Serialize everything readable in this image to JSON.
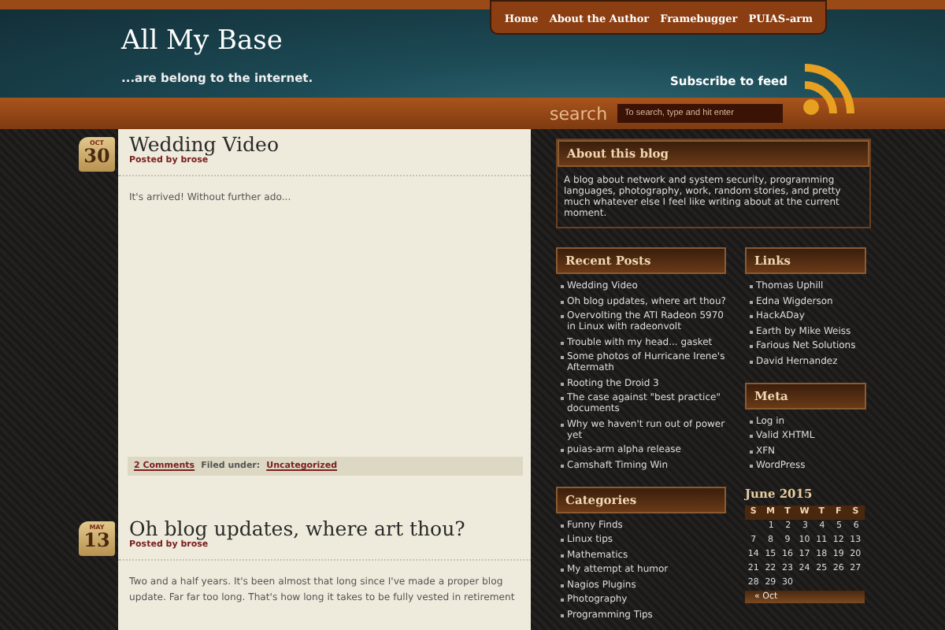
{
  "nav": [
    "Home",
    "About the Author",
    "Framebugger",
    "PUIAS-arm"
  ],
  "site": {
    "title": "All My Base",
    "tagline": "...are belong to the internet.",
    "subscribe": "Subscribe to feed"
  },
  "search": {
    "label": "search",
    "placeholder": "To search, type and hit enter"
  },
  "posts": [
    {
      "month": "OCT",
      "day": "30",
      "title": "Wedding Video",
      "byline": "Posted by brose",
      "body": [
        "It's arrived! Without further ado..."
      ],
      "comments": "2 Comments",
      "filed_label": "Filed under:",
      "category": "Uncategorized"
    },
    {
      "month": "MAY",
      "day": "13",
      "title": "Oh blog updates, where art thou?",
      "byline": "Posted by brose",
      "body": [
        "Two and a half years. It's been almost that long since I've made a proper blog",
        "update. Far far too long. That's how long it takes to be fully vested in retirement"
      ]
    }
  ],
  "about": {
    "title": "About this blog",
    "text": "A blog about network and system security, programming languages, photography, work, random stories, and pretty much whatever else I feel like writing about at the current moment."
  },
  "recent_posts": {
    "title": "Recent Posts",
    "items": [
      "Wedding Video",
      "Oh blog updates, where art thou?",
      "Overvolting the ATI Radeon 5970 in Linux with radeonvolt",
      "Trouble with my head... gasket",
      "Some photos of Hurricane Irene's Aftermath",
      "Rooting the Droid 3",
      "The case against \"best practice\" documents",
      "Why we haven't run out of power yet",
      "puias-arm alpha release",
      "Camshaft Timing Win"
    ]
  },
  "links": {
    "title": "Links",
    "items": [
      "Thomas Uphill",
      "Edna Wigderson",
      "HackADay",
      "Earth by Mike Weiss",
      "Farious Net Solutions",
      "David Hernandez"
    ]
  },
  "meta": {
    "title": "Meta",
    "items": [
      "Log in",
      "Valid XHTML",
      "XFN",
      "WordPress"
    ]
  },
  "categories": {
    "title": "Categories",
    "items": [
      "Funny Finds",
      "Linux tips",
      "Mathematics",
      "My attempt at humor",
      "Nagios Plugins",
      "Photography",
      "Programming Tips"
    ]
  },
  "calendar": {
    "title": "June 2015",
    "weekdays": [
      "S",
      "M",
      "T",
      "W",
      "T",
      "F",
      "S"
    ],
    "weeks": [
      [
        "1",
        "2",
        "3",
        "4",
        "5",
        "6"
      ],
      [
        "7",
        "8",
        "9",
        "10",
        "11",
        "12",
        "13"
      ],
      [
        "14",
        "15",
        "16",
        "17",
        "18",
        "19",
        "20"
      ],
      [
        "21",
        "22",
        "23",
        "24",
        "25",
        "26",
        "27"
      ],
      [
        "28",
        "29",
        "30"
      ]
    ],
    "prev": "« Oct"
  }
}
